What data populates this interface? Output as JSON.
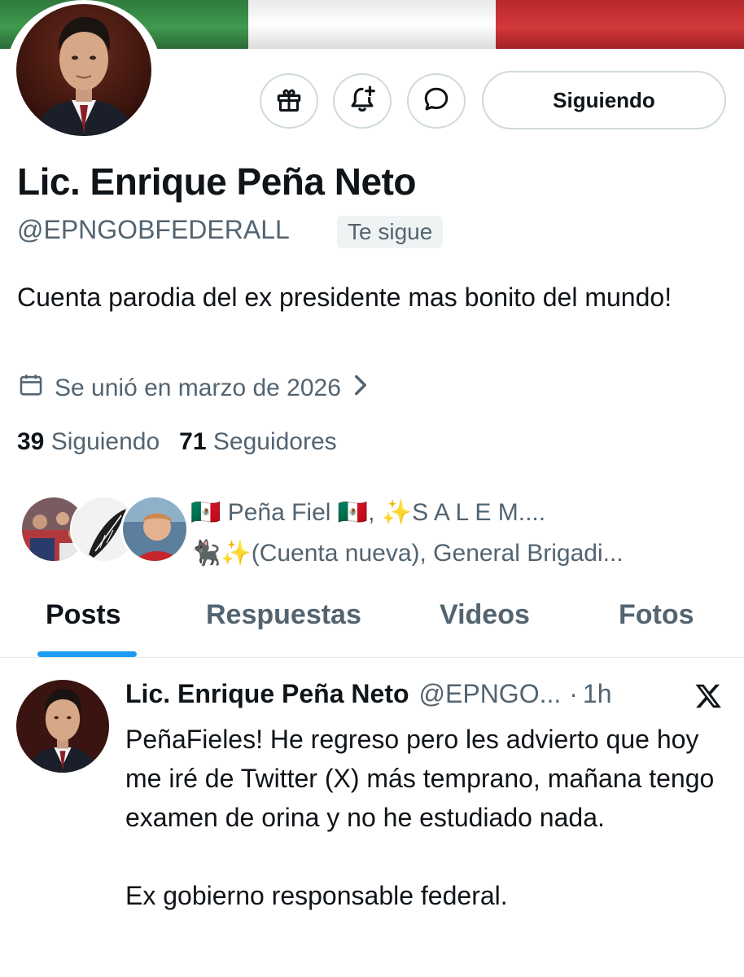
{
  "profile": {
    "display_name": "Lic. Enrique Peña Neto",
    "handle": "@EPNGOBFEDERALL",
    "follows_you_badge": "Te sigue",
    "bio": "Cuenta parodia del ex presidente mas bonito del mundo!",
    "joined": "Se unió en marzo de 2026",
    "following_count": "39",
    "following_label": "Siguiendo",
    "followers_count": "71",
    "followers_label": "Seguidores",
    "followed_by_line1": "🇲🇽 Peña Fiel 🇲🇽, ✨S A L E M....",
    "followed_by_line2": "🐈‍⬛✨(Cuenta nueva), General Brigadi..."
  },
  "actions": {
    "follow_button": "Siguiendo",
    "icons": [
      "gift-icon",
      "notification-bell-icon",
      "message-icon"
    ]
  },
  "tabs": [
    {
      "label": "Posts",
      "active": true
    },
    {
      "label": "Respuestas",
      "active": false
    },
    {
      "label": "Videos",
      "active": false
    },
    {
      "label": "Fotos",
      "active": false
    }
  ],
  "tweet": {
    "author_name": "Lic. Enrique Peña Neto",
    "author_handle": "@EPNGO...",
    "separator": "·",
    "time": "1h",
    "text_line1": "PeñaFieles! He regreso pero les advierto que hoy me iré de Twitter (X) más temprano, mañana tengo examen de orina y no he estudiado nada.",
    "text_line2": "Ex gobierno responsable federal."
  },
  "colors": {
    "accent": "#1d9bf0",
    "text_primary": "#0f1419",
    "text_secondary": "#536471",
    "border": "#cfd9de",
    "flag_green": "#3f9a4e",
    "flag_white": "#ffffff",
    "flag_red": "#d2393b"
  }
}
